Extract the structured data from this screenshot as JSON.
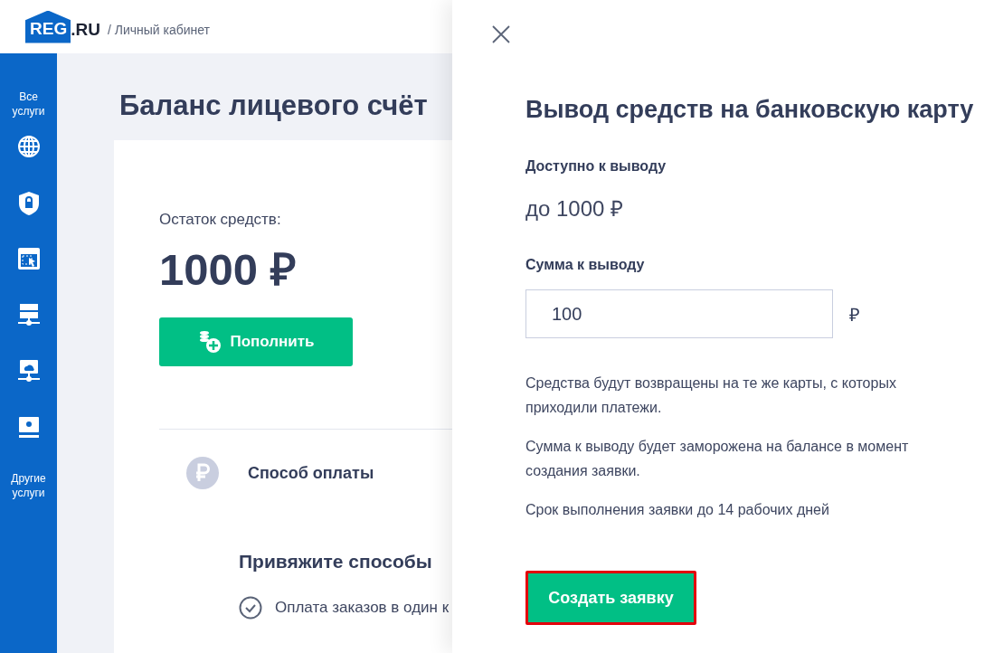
{
  "header": {
    "logo_text": "REG",
    "logo_suffix": ".RU",
    "breadcrumb": "/ Личный кабинет"
  },
  "sidebar": {
    "items": [
      {
        "kind": "text",
        "label": "Все услуги"
      },
      {
        "kind": "globe"
      },
      {
        "kind": "shield"
      },
      {
        "kind": "window"
      },
      {
        "kind": "server"
      },
      {
        "kind": "cloud"
      },
      {
        "kind": "monitor"
      },
      {
        "kind": "text",
        "label": "Другие услуги"
      }
    ]
  },
  "page": {
    "title": "Баланс лицевого счёт",
    "balance_label": "Остаток средств:",
    "balance": "1000 ₽",
    "topup_button": "Пополнить",
    "payment_method": "Способ оплаты",
    "bind_heading": "Привяжите способы",
    "benefit": "Оплата заказов в один к"
  },
  "drawer": {
    "title": "Вывод средств на банковскую карту",
    "available_label": "Доступно к выводу",
    "available_value": "до 1000 ₽",
    "amount_label": "Сумма к выводу",
    "amount_value": "100",
    "currency": "₽",
    "notes": [
      "Средства будут возвращены на те же карты, с которых приходили платежи.",
      "Сумма к выводу будет заморожена на балансе в момент создания заявки.",
      "Срок выполнения заявки до 14 рабочих дней"
    ],
    "submit_button": {
      "label": "Создать заявку",
      "highlighted": true
    }
  }
}
